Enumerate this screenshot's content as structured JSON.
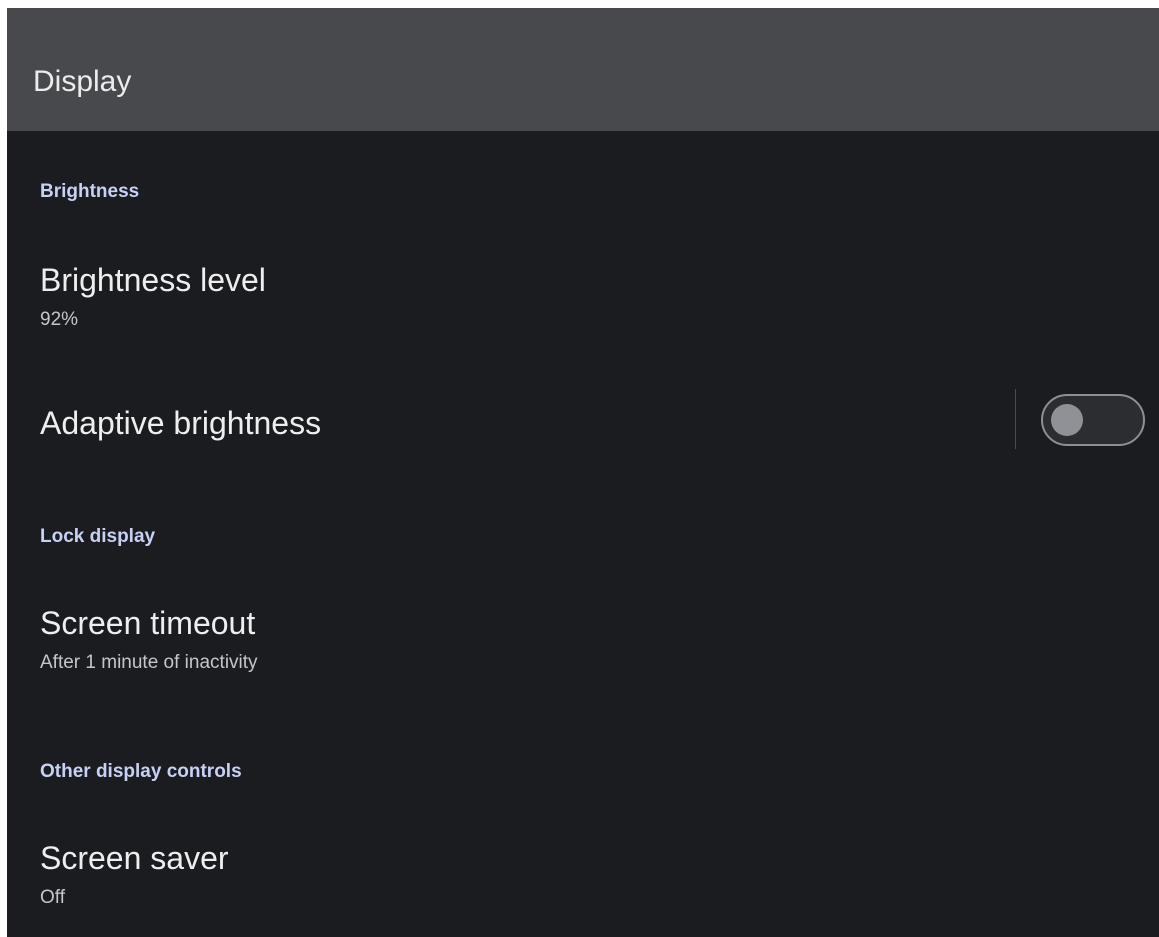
{
  "app_bar": {
    "title": "Display"
  },
  "sections": {
    "brightness": {
      "header": "Brightness",
      "brightness_level": {
        "title": "Brightness level",
        "summary": "92%"
      },
      "adaptive_brightness": {
        "title": "Adaptive brightness",
        "switch_on": false
      }
    },
    "lock_display": {
      "header": "Lock display",
      "screen_timeout": {
        "title": "Screen timeout",
        "summary": "After 1 minute of inactivity"
      }
    },
    "other_display_controls": {
      "header": "Other display controls",
      "screen_saver": {
        "title": "Screen saver",
        "summary": "Off"
      }
    }
  },
  "colors": {
    "background": "#1b1c1f",
    "app_bar": "#48494c",
    "section_header": "#c7d1f4",
    "title_text": "#eeeef0",
    "summary_text": "#c5c6ca",
    "switch_thumb_off": "#909196",
    "switch_track_off_border": "#8e8f94"
  }
}
